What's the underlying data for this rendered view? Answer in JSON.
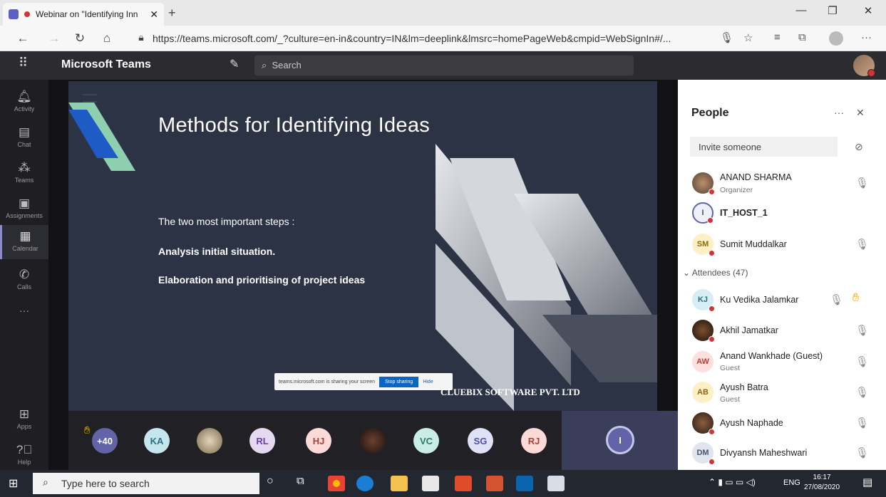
{
  "browser": {
    "tab_title": "Webinar on \"Identifying Inn",
    "new_tab_icon": "+",
    "url": "https://teams.microsoft.com/_?culture=en-in&country=IN&lm=deeplink&lmsrc=homePageWeb&cmpid=WebSignIn#/..."
  },
  "teams": {
    "brand": "Microsoft Teams",
    "search_placeholder": "Search"
  },
  "rail": [
    {
      "label": "Activity",
      "icon": "bell-icon"
    },
    {
      "label": "Chat",
      "icon": "chat-icon"
    },
    {
      "label": "Teams",
      "icon": "teams-icon"
    },
    {
      "label": "Assignments",
      "icon": "assignments-icon"
    },
    {
      "label": "Calendar",
      "icon": "calendar-icon"
    },
    {
      "label": "Calls",
      "icon": "phone-icon"
    },
    {
      "label": "Apps",
      "icon": "apps-icon"
    },
    {
      "label": "Help",
      "icon": "help-icon"
    }
  ],
  "slide": {
    "title": "Methods for Identifying Ideas",
    "intro": "The two most important steps :",
    "step1": "Analysis initial situation.",
    "step2": "Elaboration and prioritising of project ideas",
    "brand": "CLUEBIX SOFTWARE PVT. LTD"
  },
  "share_bar": {
    "text": "teams.microsoft.com is sharing your screen",
    "stop": "Stop sharing",
    "hide": "Hide"
  },
  "tray": {
    "overflow": "+40",
    "participants": [
      "KA",
      "RL",
      "HJ",
      "VC",
      "SG",
      "RJ"
    ],
    "self": "I"
  },
  "people": {
    "title": "People",
    "invite_placeholder": "Invite someone",
    "section": "Attendees (47)",
    "organizers": [
      {
        "name": "ANAND SHARMA",
        "role": "Organizer",
        "initials": ""
      },
      {
        "name": "IT_HOST_1",
        "role": "",
        "initials": "I"
      },
      {
        "name": "Sumit Muddalkar",
        "role": "",
        "initials": "SM"
      }
    ],
    "attendees": [
      {
        "name": "Ku Vedika Jalamkar",
        "role": "",
        "initials": "KJ"
      },
      {
        "name": "Akhil Jamatkar",
        "role": "",
        "initials": ""
      },
      {
        "name": "Anand Wankhade (Guest)",
        "role": "Guest",
        "initials": "AW"
      },
      {
        "name": "Ayush Batra",
        "role": "Guest",
        "initials": "AB"
      },
      {
        "name": "Ayush Naphade",
        "role": "",
        "initials": ""
      },
      {
        "name": "Divyansh Maheshwari",
        "role": "",
        "initials": "DM"
      }
    ]
  },
  "taskbar": {
    "search_placeholder": "Type here to search",
    "lang": "ENG",
    "time": "16:17",
    "date": "27/08/2020"
  }
}
